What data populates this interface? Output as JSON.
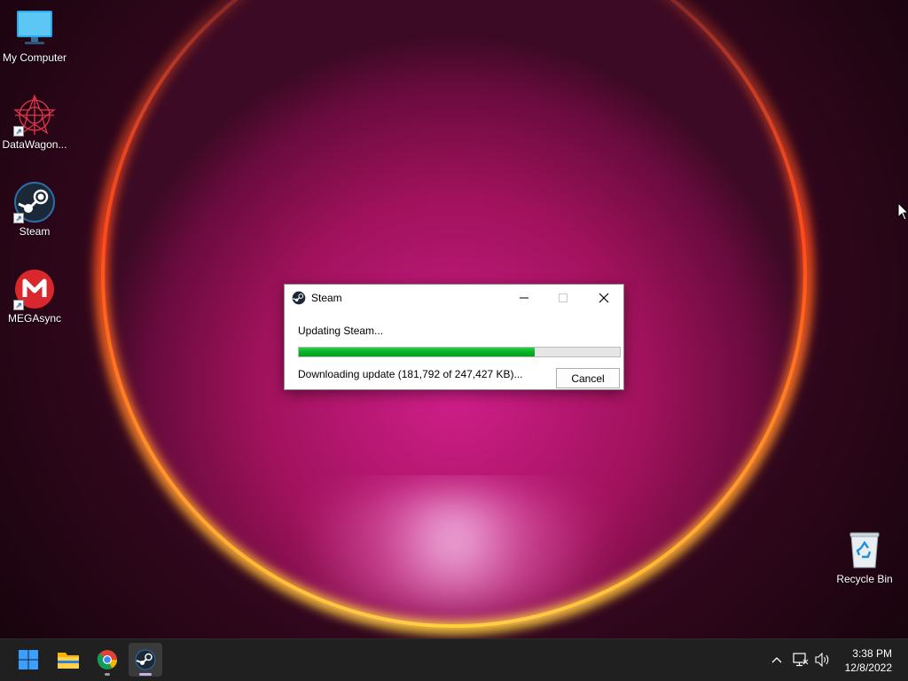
{
  "desktop": {
    "icons": [
      {
        "name": "My Computer",
        "shortcut": false,
        "icon": "monitor-icon"
      },
      {
        "name": "DataWagon...",
        "shortcut": true,
        "icon": "datawagon-icon"
      },
      {
        "name": "Steam",
        "shortcut": true,
        "icon": "steam-icon"
      },
      {
        "name": "MEGAsync",
        "shortcut": true,
        "icon": "mega-icon"
      },
      {
        "name": "Recycle Bin",
        "shortcut": false,
        "icon": "recycle-bin-icon"
      }
    ]
  },
  "dialog": {
    "title": "Steam",
    "status": "Updating Steam...",
    "progress": {
      "downloaded_kb": 181792,
      "total_kb": 247427,
      "fraction": 0.7347
    },
    "detail": "Downloading update (181,792 of 247,427 KB)...",
    "cancel_label": "Cancel",
    "controls": {
      "minimize": "minimize-icon",
      "maximize": "maximize-icon",
      "close": "close-icon"
    }
  },
  "taskbar": {
    "apps": [
      {
        "name": "Start",
        "icon": "windows-start-icon",
        "running": false
      },
      {
        "name": "File Explorer",
        "icon": "folder-icon",
        "running": false
      },
      {
        "name": "Google Chrome",
        "icon": "chrome-icon",
        "running": true
      },
      {
        "name": "Steam",
        "icon": "steam-icon",
        "running": true,
        "active": true
      }
    ],
    "tray": [
      "chevron-up-icon",
      "network-icon",
      "volume-icon"
    ],
    "time": "3:38 PM",
    "date": "12/8/2022"
  },
  "colors": {
    "progress_fill": "#06b025",
    "taskbar": "#202020",
    "accent": "#0078d4",
    "mega_red": "#d9272e",
    "steam_blue": "#1b2838"
  }
}
